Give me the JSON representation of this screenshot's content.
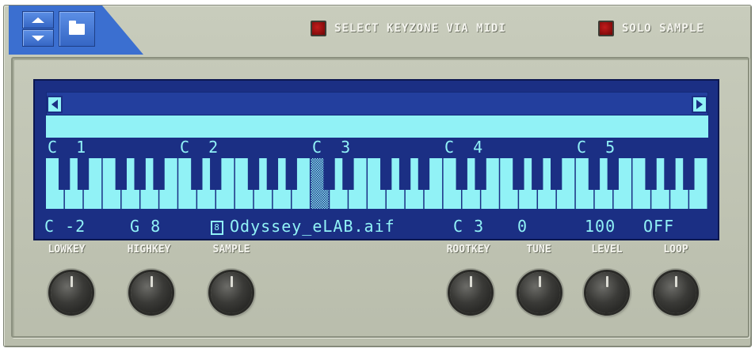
{
  "toggles": {
    "select_keyzone": "SELECT KEYZONE VIA MIDI",
    "solo_sample": "SOLO SAMPLE"
  },
  "keyboard": {
    "octave_labels": [
      "C 1",
      "C 2",
      "C 3",
      "C 4",
      "C 5"
    ],
    "highlighted_key": "C 3"
  },
  "params": {
    "lowkey": "C -2",
    "highkey": "G 8",
    "sample_index": "8",
    "sample_name": "Odyssey_eLAB.aif",
    "rootkey": "C 3",
    "tune": "0",
    "level": "100",
    "loop": "OFF"
  },
  "knob_labels": {
    "lowkey": "LOWKEY",
    "highkey": "HIGHKEY",
    "sample": "SAMPLE",
    "rootkey": "ROOTKEY",
    "tune": "TUNE",
    "level": "LEVEL",
    "loop": "LOOP"
  },
  "colors": {
    "display_bg": "#1b2f84",
    "display_fg": "#91f2f6",
    "nav_blue": "#3b6fd0",
    "led_red": "#a01212",
    "panel": "#c0c4b3"
  },
  "icons": {
    "nav_up": "arrow-up-icon",
    "nav_down": "arrow-down-icon",
    "browse": "folder-icon",
    "scroll_left": "arrow-left-icon",
    "scroll_right": "arrow-right-icon"
  }
}
